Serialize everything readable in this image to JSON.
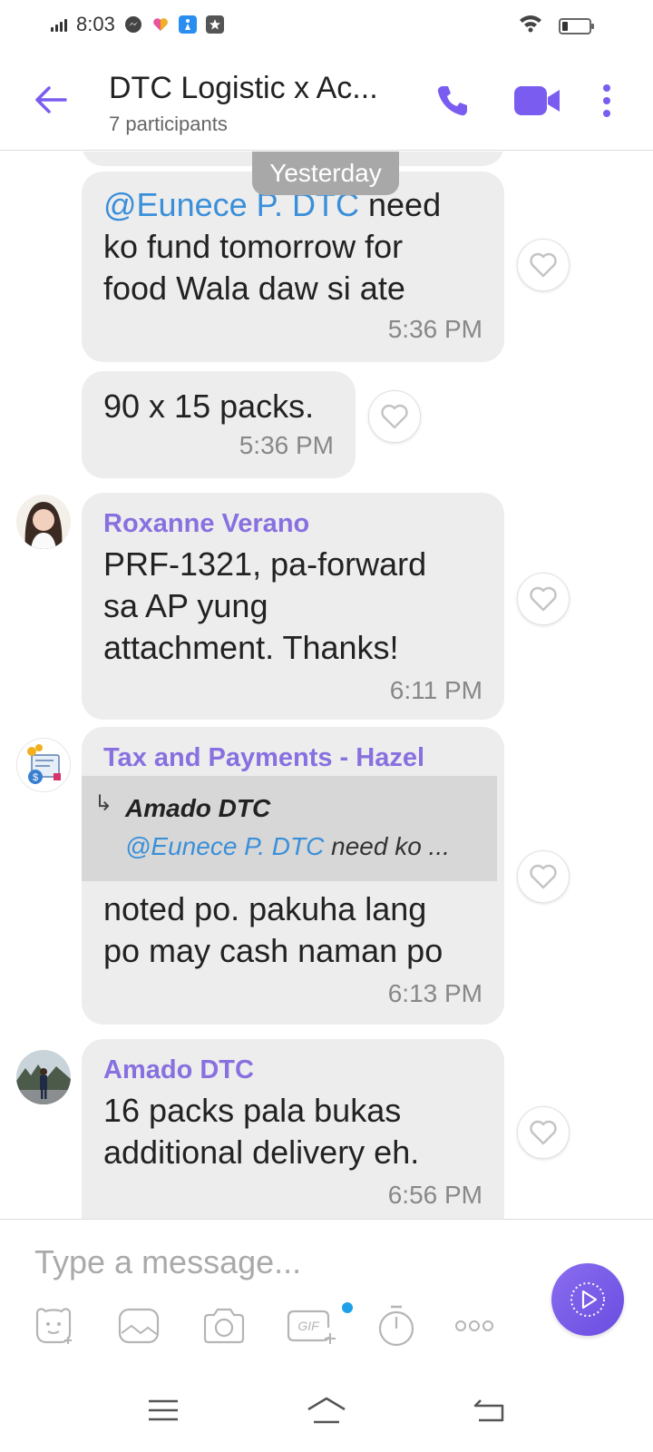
{
  "status_bar": {
    "time": "8:03",
    "icons": [
      "messenger-icon",
      "health-icon",
      "cleaner-icon",
      "star-icon"
    ],
    "battery_level": 0.2
  },
  "header": {
    "title": "DTC Logistic x Ac...",
    "subtitle": "7 participants",
    "accent_color": "#7a5df0"
  },
  "chat": {
    "date_separator": "Yesterday",
    "messages": [
      {
        "mention": "@Eunece P. DTC",
        "line1_rest": "  need",
        "line2": "ko fund tomorrow for",
        "line3": "food Wala daw si ate",
        "time": "5:36 PM"
      },
      {
        "text": "90 x 15 packs.",
        "time": "5:36 PM"
      },
      {
        "sender": "Roxanne Verano",
        "line1": "PRF-1321, pa-forward",
        "line2": "sa AP yung",
        "line3": "attachment. Thanks!",
        "time": "6:11 PM"
      },
      {
        "sender": "Tax and Payments - Hazel",
        "quote_name": "Amado DTC",
        "quote_mention": "@Eunece P. DTC",
        "quote_rest": "  need ko ...",
        "line1": "noted po. pakuha lang",
        "line2": "po may cash naman po",
        "time": "6:13 PM"
      },
      {
        "sender": "Amado DTC",
        "line1": "16 packs pala bukas",
        "line2": "additional delivery eh.",
        "time": "6:56 PM"
      }
    ]
  },
  "composer": {
    "placeholder": "Type a message...",
    "tools": [
      "sticker-icon",
      "gallery-icon",
      "camera-icon",
      "gif-icon",
      "timer-icon",
      "more-icon"
    ],
    "gif_label": "GIF"
  },
  "navbar": {
    "buttons": [
      "menu",
      "home",
      "back"
    ]
  }
}
